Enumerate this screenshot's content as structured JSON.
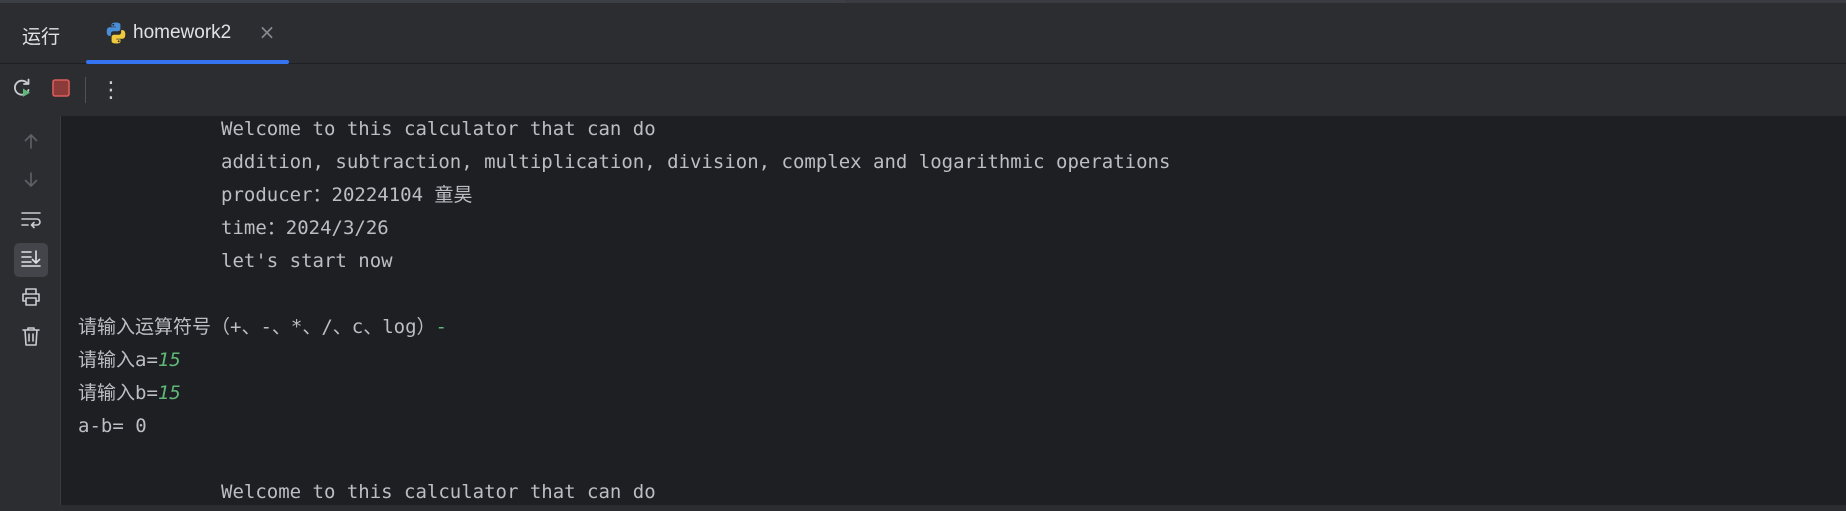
{
  "panel": {
    "title": "运行"
  },
  "tabs": [
    {
      "label": "homework2",
      "icon": "python-icon",
      "active": true,
      "close_glyph": "×"
    }
  ],
  "toolbar": {
    "more_glyph": "⋮",
    "buttons": [
      "rerun-icon",
      "stop-icon",
      "more-icon"
    ]
  },
  "gutter": {
    "buttons": [
      "arrow-up-icon",
      "arrow-down-icon",
      "soft-wrap-icon",
      "scroll-to-end-icon",
      "print-icon",
      "trash-icon"
    ]
  },
  "colors": {
    "accent": "#3574f0",
    "stop": "#db5c5c",
    "rerun_green": "#5fb878",
    "input_green": "#5fb878",
    "text": "#bcbec4",
    "background": "#1e1f22"
  },
  "console": {
    "banner1": [
      "Welcome to this calculator that can do",
      "addition, subtraction, multiplication, division, complex and logarithmic operations",
      "producer：20224104 童昊",
      "time：2024/3/26",
      "let's start now"
    ],
    "prompt_op": "请输入运算符号（+、-、*、/、c、log）",
    "op_input": "-",
    "prompt_a": "请输入a=",
    "a_input": "15",
    "prompt_b": "请输入b=",
    "b_input": "15",
    "result": "a-b= 0",
    "banner2_line1": "Welcome to this calculator that can do"
  }
}
